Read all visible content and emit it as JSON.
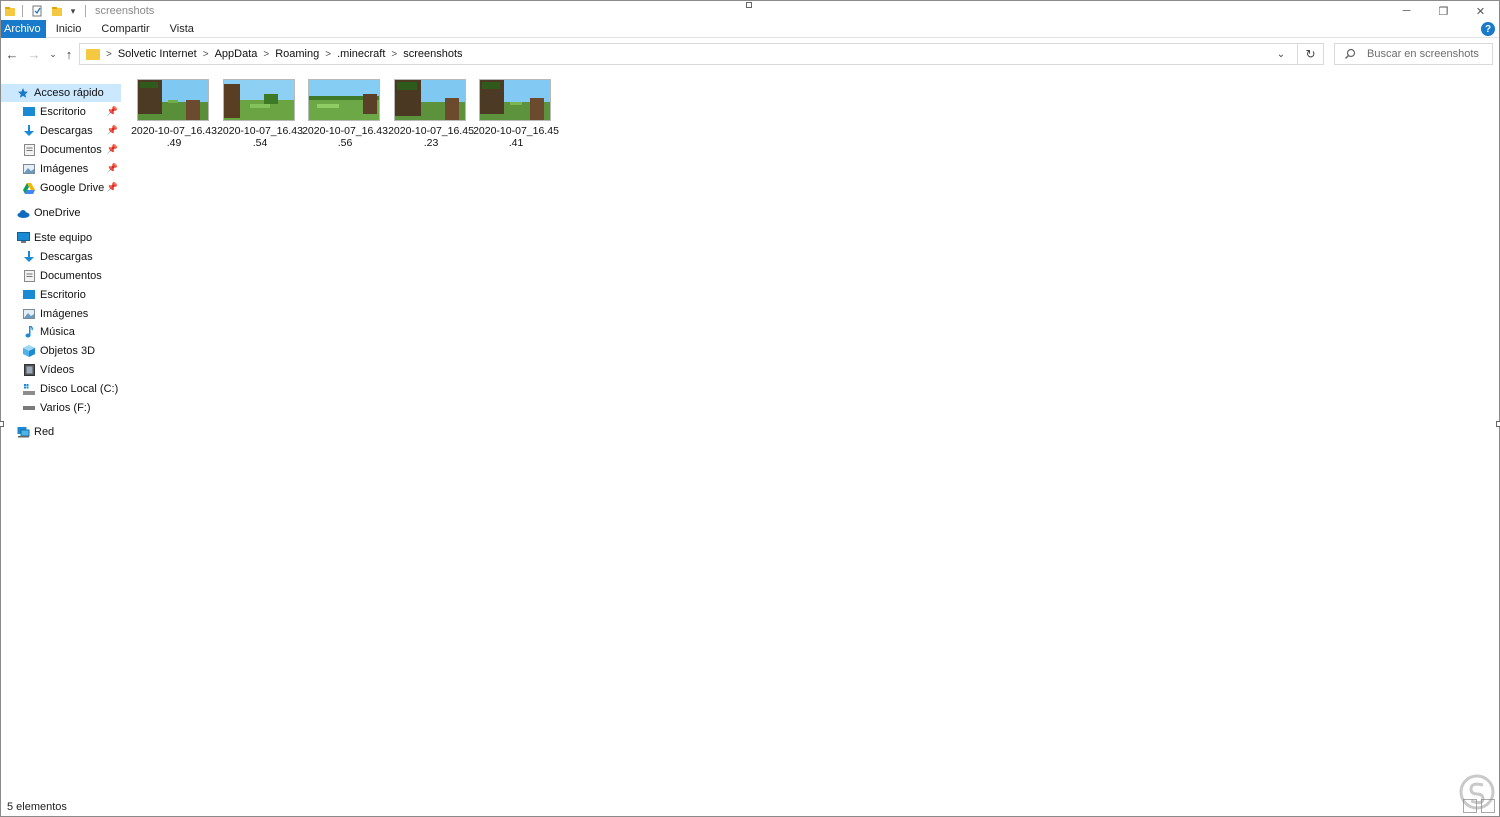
{
  "window": {
    "title": "screenshots",
    "controls": {
      "minimize": "─",
      "restore": "❐",
      "close": "✕"
    }
  },
  "ribbon": {
    "tabs": [
      "Archivo",
      "Inicio",
      "Compartir",
      "Vista"
    ],
    "help": "?"
  },
  "address_bar": {
    "breadcrumb": [
      "Solvetic Internet",
      "AppData",
      "Roaming",
      ".minecraft",
      "screenshots"
    ],
    "separator": ">"
  },
  "search": {
    "placeholder": "Buscar en screenshots"
  },
  "sidebar": {
    "quick_access": {
      "label": "Acceso rápido",
      "items": [
        {
          "label": "Escritorio",
          "icon": "desktop-icon"
        },
        {
          "label": "Descargas",
          "icon": "download-icon"
        },
        {
          "label": "Documentos",
          "icon": "documents-icon"
        },
        {
          "label": "Imágenes",
          "icon": "pictures-icon"
        },
        {
          "label": "Google Drive",
          "icon": "google-drive-icon"
        }
      ]
    },
    "onedrive": {
      "label": "OneDrive"
    },
    "this_pc": {
      "label": "Este equipo",
      "items": [
        {
          "label": "Descargas",
          "icon": "download-icon"
        },
        {
          "label": "Documentos",
          "icon": "documents-icon"
        },
        {
          "label": "Escritorio",
          "icon": "desktop-icon"
        },
        {
          "label": "Imágenes",
          "icon": "pictures-icon"
        },
        {
          "label": "Música",
          "icon": "music-icon"
        },
        {
          "label": "Objetos 3D",
          "icon": "3d-objects-icon"
        },
        {
          "label": "Vídeos",
          "icon": "videos-icon"
        },
        {
          "label": "Disco Local (C:)",
          "icon": "local-disk-icon"
        },
        {
          "label": "Varios (F:)",
          "icon": "drive-icon"
        }
      ]
    },
    "network": {
      "label": "Red"
    }
  },
  "files": [
    {
      "name_line1": "2020-10-07_16.43",
      "name_line2": ".49"
    },
    {
      "name_line1": "2020-10-07_16.43",
      "name_line2": ".54"
    },
    {
      "name_line1": "2020-10-07_16.43",
      "name_line2": ".56"
    },
    {
      "name_line1": "2020-10-07_16.45",
      "name_line2": ".23"
    },
    {
      "name_line1": "2020-10-07_16.45",
      "name_line2": ".41"
    }
  ],
  "status_bar": {
    "item_count": "5 elementos"
  },
  "colors": {
    "accent": "#1979ca",
    "selected_bg": "#cce8ff",
    "folder": "#f5c842"
  }
}
